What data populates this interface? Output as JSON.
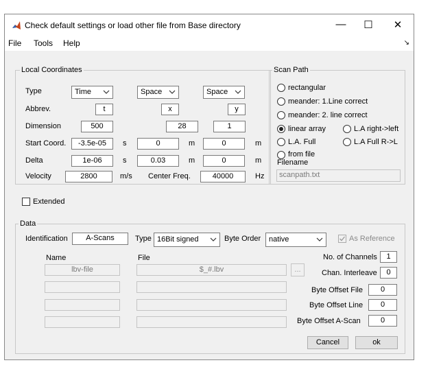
{
  "window": {
    "title": "Check default settings or load other file from Base directory",
    "minimize": "—",
    "maximize": "☐",
    "close": "✕"
  },
  "menu": {
    "items": [
      "File",
      "Tools",
      "Help"
    ],
    "dock": "↘"
  },
  "local_coords": {
    "legend": "Local Coordinates",
    "row_labels": {
      "type": "Type",
      "abbrev": "Abbrev.",
      "dimension": "Dimension",
      "start": "Start Coord.",
      "delta": "Delta",
      "velocity": "Velocity"
    },
    "columns": [
      {
        "type": "Time",
        "abbrev": "t",
        "dimension": "500",
        "start": "-3.5e-05",
        "start_unit": "s",
        "delta": "1e-06",
        "delta_unit": "s"
      },
      {
        "type": "Space",
        "abbrev": "x",
        "dimension": "28",
        "start": "0",
        "start_unit": "m",
        "delta": "0.03",
        "delta_unit": "m"
      },
      {
        "type": "Space",
        "abbrev": "y",
        "dimension": "1",
        "start": "0",
        "start_unit": "m",
        "delta": "0",
        "delta_unit": "m"
      }
    ],
    "velocity": "2800",
    "velocity_unit": "m/s",
    "center_freq_label": "Center Freq.",
    "center_freq": "40000",
    "freq_unit": "Hz"
  },
  "scan_path": {
    "legend": "Scan Path",
    "options": [
      "rectangular",
      "meander: 1.Line correct",
      "meander: 2. line correct",
      "linear array",
      "L.A right->left",
      "L.A. Full",
      "L.A Full R->L",
      "from file"
    ],
    "selected": "linear array",
    "filename_label": "Filename",
    "filename": "scanpath.txt"
  },
  "extended": {
    "label": "Extended",
    "checked": false
  },
  "data": {
    "legend": "Data",
    "identification_label": "Identification",
    "identification": "A-Scans",
    "type_label": "Type",
    "type": "16Bit signed",
    "byte_order_label": "Byte Order",
    "byte_order": "native",
    "as_reference": {
      "label": "As Reference",
      "checked": true,
      "enabled": false
    },
    "name_header": "Name",
    "file_header": "File",
    "rows": [
      {
        "name": "lbv-file",
        "file": "$_#.lbv"
      },
      {
        "name": "",
        "file": ""
      },
      {
        "name": "",
        "file": ""
      },
      {
        "name": "",
        "file": ""
      }
    ],
    "browse": "...",
    "channels_label": "No. of Channels",
    "channels": "1",
    "interleave_label": "Chan. Interleave",
    "interleave": "0",
    "offset_file_label": "Byte Offset File",
    "offset_file": "0",
    "offset_line_label": "Byte Offset Line",
    "offset_line": "0",
    "offset_ascan_label": "Byte Offset A-Scan",
    "offset_ascan": "0"
  },
  "buttons": {
    "cancel": "Cancel",
    "ok": "ok"
  }
}
